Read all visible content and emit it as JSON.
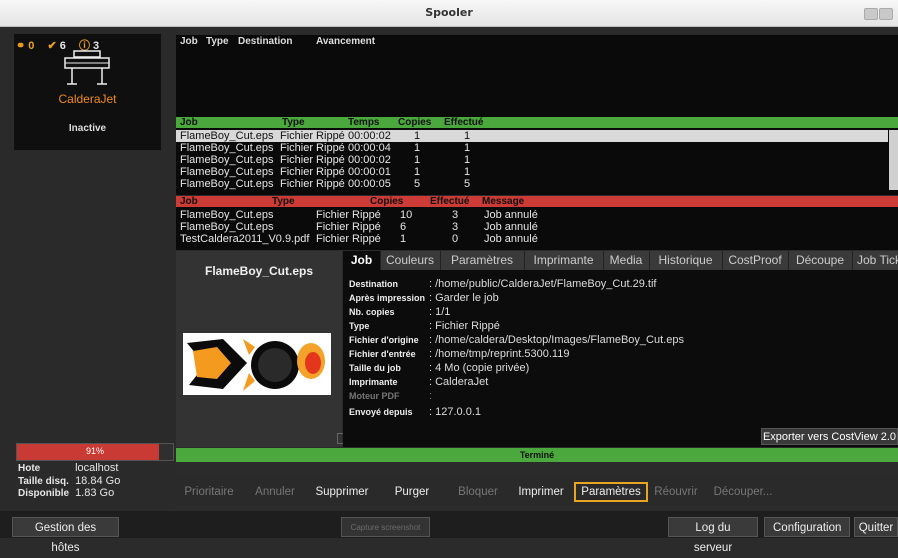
{
  "window": {
    "title": "Spooler"
  },
  "printer": {
    "counts": {
      "keys": "0",
      "checks": "6",
      "warnings": "3"
    },
    "name": "CalderaJet",
    "status": "Inactive"
  },
  "disk": {
    "percent_label": "91%",
    "percent": 91
  },
  "host_info": [
    {
      "label": "Hote",
      "value": "localhost"
    },
    {
      "label": "Taille disq.",
      "value": "18.84 Go"
    },
    {
      "label": "Disponible",
      "value": "1.83 Go"
    }
  ],
  "queue": {
    "headers": [
      "Job",
      "Type",
      "Destination",
      "Avancement"
    ]
  },
  "completed": {
    "headers": [
      "Job",
      "Type",
      "Temps",
      "Copies",
      "Effectué"
    ],
    "rows": [
      {
        "job": "FlameBoy_Cut.eps",
        "type": "Fichier Rippé",
        "time": "00:00:02",
        "copies": "1",
        "done": "1",
        "selected": true
      },
      {
        "job": "FlameBoy_Cut.eps",
        "type": "Fichier Rippé",
        "time": "00:00:04",
        "copies": "1",
        "done": "1"
      },
      {
        "job": "FlameBoy_Cut.eps",
        "type": "Fichier Rippé",
        "time": "00:00:02",
        "copies": "1",
        "done": "1"
      },
      {
        "job": "FlameBoy_Cut.eps",
        "type": "Fichier Rippé",
        "time": "00:00:01",
        "copies": "1",
        "done": "1"
      },
      {
        "job": "FlameBoy_Cut.eps",
        "type": "Fichier Rippé",
        "time": "00:00:05",
        "copies": "5",
        "done": "5"
      }
    ]
  },
  "cancelled": {
    "headers": [
      "Job",
      "Type",
      "Copies",
      "Effectué",
      "Message"
    ],
    "rows": [
      {
        "job": "FlameBoy_Cut.eps",
        "type": "Fichier Rippé",
        "copies": "10",
        "done": "3",
        "message": "Job annulé"
      },
      {
        "job": "FlameBoy_Cut.eps",
        "type": "Fichier Rippé",
        "copies": "6",
        "done": "3",
        "message": "Job annulé"
      },
      {
        "job": "TestCaldera2011_V0.9.pdf",
        "type": "Fichier Rippé",
        "copies": "1",
        "done": "0",
        "message": "Job annulé"
      }
    ]
  },
  "preview": {
    "filename": "FlameBoy_Cut.eps"
  },
  "tabs": [
    "Job",
    "Couleurs",
    "Paramètres",
    "Imprimante",
    "Media",
    "Historique",
    "CostProof",
    "Découpe",
    "Job Ticket"
  ],
  "details": [
    {
      "label": "Destination",
      "value": ": /home/public/CalderaJet/FlameBoy_Cut.29.tif"
    },
    {
      "label": "Après impression",
      "value": ": Garder le job"
    },
    {
      "label": "Nb. copies",
      "value": ": 1/1"
    },
    {
      "label": "Type",
      "value": ": Fichier Rippé"
    },
    {
      "label": "Fichier d'origine",
      "value": ": /home/caldera/Desktop/Images/FlameBoy_Cut.eps"
    },
    {
      "label": "Fichier d'entrée",
      "value": ": /home/tmp/reprint.5300.119"
    },
    {
      "label": "Taille du job",
      "value": ": 4 Mo (copie privée)"
    },
    {
      "label": "Imprimante",
      "value": ": CalderaJet"
    },
    {
      "label": "Moteur PDF",
      "value": ":"
    },
    {
      "label": "Envoyé depuis",
      "value": ": 127.0.0.1"
    }
  ],
  "export_button": "Exporter vers CostView 2.0",
  "status_bar": "Terminé",
  "actions": [
    "Prioritaire",
    "Annuler",
    "Supprimer",
    "Purger",
    "Bloquer",
    "Imprimer",
    "Paramètres",
    "Réouvrir",
    "Découper..."
  ],
  "bottom": {
    "hosts": "Gestion des hôtes",
    "capture": "Capture screenshot",
    "log": "Log du serveur",
    "config": "Configuration",
    "quit": "Quitter"
  },
  "colors": {
    "accent_orange": "#f08c1a",
    "green_header": "#4aa83d",
    "red_header": "#cc3b35",
    "highlight": "#e8a524"
  }
}
